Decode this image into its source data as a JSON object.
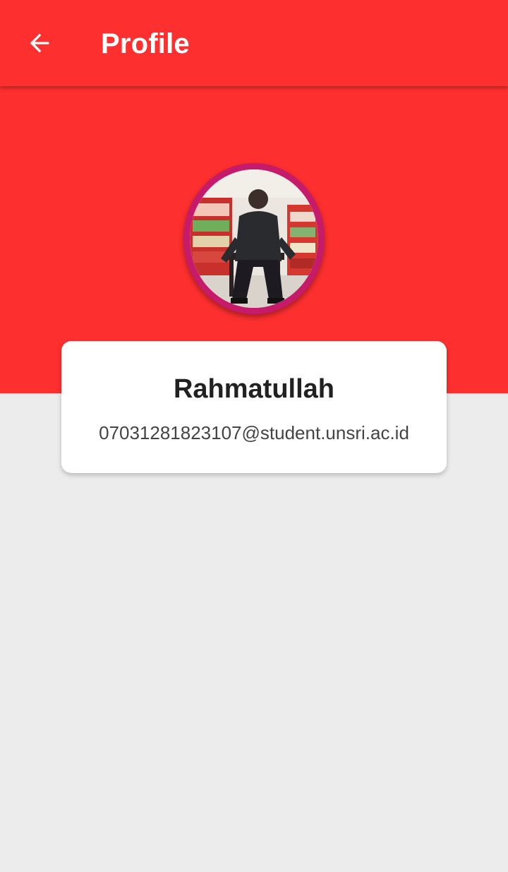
{
  "app": {
    "title": "Profile",
    "colors": {
      "primary": "#fe2f2f",
      "avatar_ring": "#c61a6a",
      "background": "#ececec",
      "card": "#ffffff"
    }
  },
  "toolbar": {
    "back_icon": "arrow-left-icon",
    "title": "Profile"
  },
  "profile": {
    "avatar_alt": "profile photo",
    "name": "Rahmatullah",
    "email": "07031281823107@student.unsri.ac.id"
  }
}
